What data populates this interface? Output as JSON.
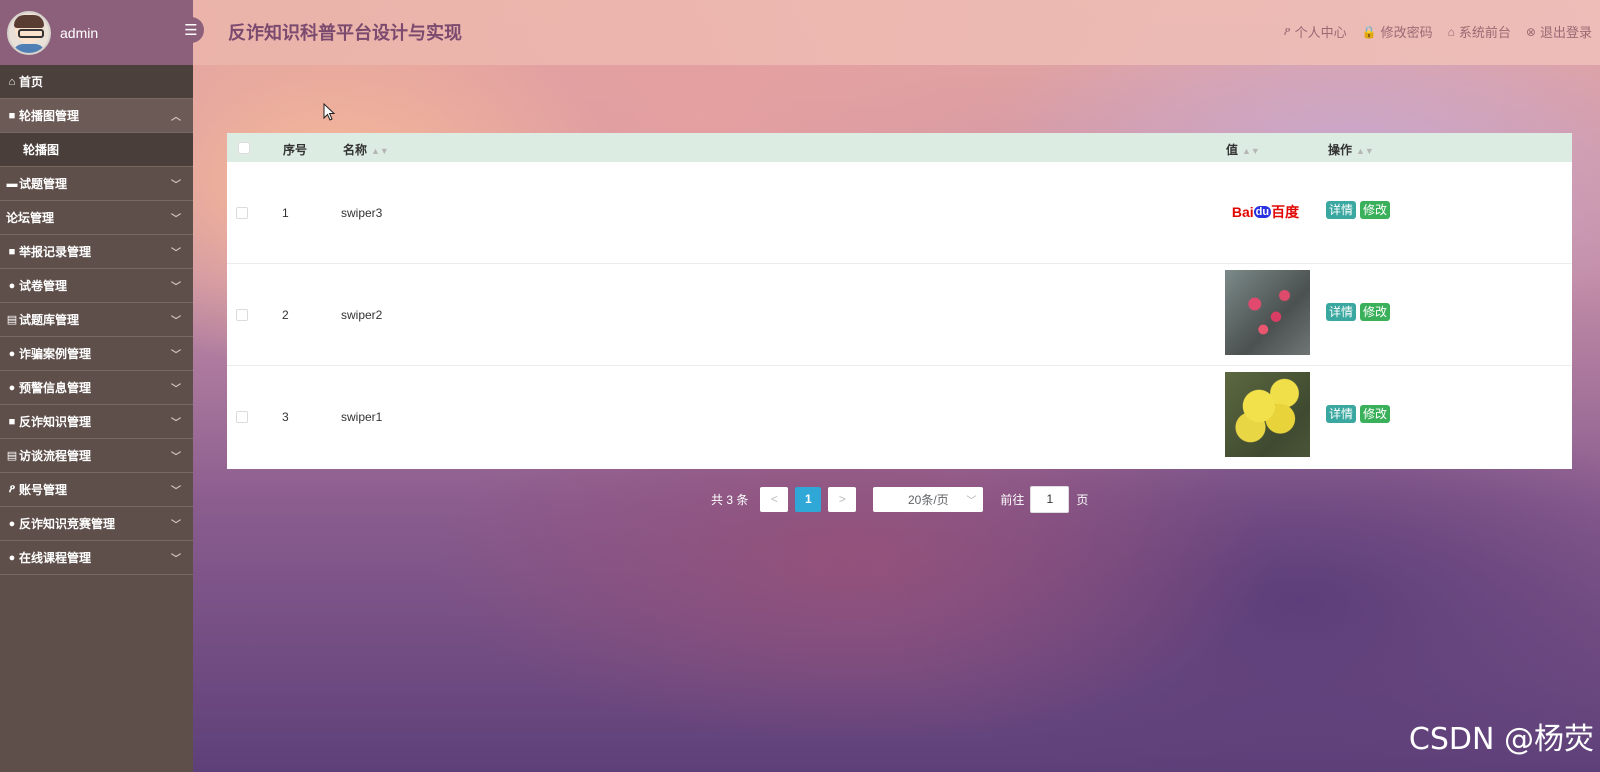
{
  "colors": {
    "sidebar_bg": "#5e4f4a",
    "sidebar_header_bg": "#8c5f7b",
    "table_header_bg": "#dcece2",
    "detail_button": "#3aa7a0",
    "edit_button": "#3bb05b",
    "active_page": "#2fa8d8"
  },
  "user": {
    "name": "admin"
  },
  "header": {
    "title": "反诈知识科普平台设计与实现",
    "links": [
      {
        "label": "个人中心",
        "icon": "user-icon"
      },
      {
        "label": "修改密码",
        "icon": "lock-icon"
      },
      {
        "label": "系统前台",
        "icon": "home-icon"
      },
      {
        "label": "退出登录",
        "icon": "close-circle-icon"
      }
    ]
  },
  "sidebar": {
    "items": [
      {
        "label": "首页",
        "icon": "home-icon"
      },
      {
        "label": "轮播图管理",
        "icon": "picture-icon",
        "expanded": true,
        "children": [
          {
            "label": "轮播图"
          }
        ]
      },
      {
        "label": "试题管理",
        "icon": "document-icon"
      },
      {
        "label": "论坛管理",
        "icon": ""
      },
      {
        "label": "举报记录管理",
        "icon": "list-icon"
      },
      {
        "label": "试卷管理",
        "icon": "circle-icon"
      },
      {
        "label": "试题库管理",
        "icon": "document-icon"
      },
      {
        "label": "诈骗案例管理",
        "icon": "circle-icon"
      },
      {
        "label": "预警信息管理",
        "icon": "circle-icon"
      },
      {
        "label": "反诈知识管理",
        "icon": "list-icon"
      },
      {
        "label": "访谈流程管理",
        "icon": "list-icon"
      },
      {
        "label": "账号管理",
        "icon": "user-icon"
      },
      {
        "label": "反诈知识竞赛管理",
        "icon": "circle-icon"
      },
      {
        "label": "在线课程管理",
        "icon": "circle-icon"
      }
    ]
  },
  "table": {
    "columns": [
      "序号",
      "名称",
      "值",
      "操作"
    ],
    "rows": [
      {
        "index": "1",
        "name": "swiper3",
        "image": "baidu-logo",
        "logo_text_left": "Bai",
        "logo_text_mid": "du",
        "logo_text_right": "百度"
      },
      {
        "index": "2",
        "name": "swiper2",
        "image": "pink-flower-photo"
      },
      {
        "index": "3",
        "name": "swiper1",
        "image": "yellow-flower-photo"
      }
    ],
    "actions": {
      "detail": "详情",
      "edit": "修改"
    }
  },
  "pagination": {
    "total_text": "共 3 条",
    "prev": "<",
    "next": ">",
    "current_page": "1",
    "page_size": "20条/页",
    "goto_label": "前往",
    "goto_value": "1",
    "page_suffix": "页"
  },
  "watermark": "CSDN @杨荧"
}
